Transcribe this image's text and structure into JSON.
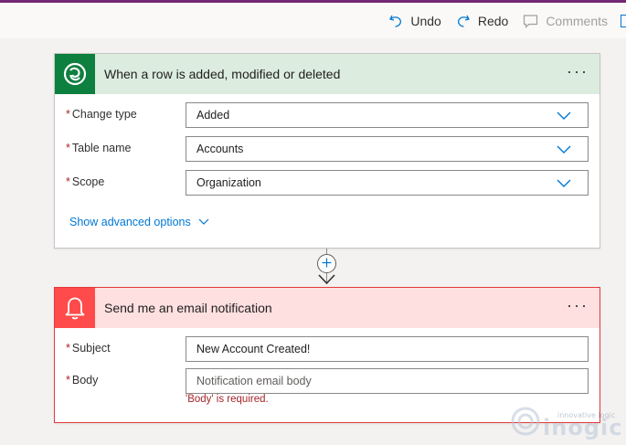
{
  "toolbar": {
    "undo_label": "Undo",
    "redo_label": "Redo",
    "comments_label": "Comments"
  },
  "trigger": {
    "title": "When a row is added, modified or deleted",
    "fields": [
      {
        "label": "Change type",
        "value": "Added"
      },
      {
        "label": "Table name",
        "value": "Accounts"
      },
      {
        "label": "Scope",
        "value": "Organization"
      }
    ],
    "advanced_options_label": "Show advanced options"
  },
  "action": {
    "title": "Send me an email notification",
    "subject_label": "Subject",
    "subject_value": "New Account Created!",
    "body_label": "Body",
    "body_placeholder": "Notification email body",
    "body_error": "'Body' is required."
  },
  "required_marker": "*",
  "more_glyph": "···",
  "watermark": {
    "tagline": "innovative logic",
    "brand": "inogic"
  },
  "colors": {
    "accent": "#742774",
    "dataverse_green": "#0d7f3f",
    "trigger_header": "#dcecdf",
    "notification_red": "#ff4b4b",
    "action_header": "#fde0df",
    "error_red": "#a4262c",
    "link_blue": "#0078d4"
  },
  "icons": {
    "trigger_icon": "dataverse-icon",
    "action_icon": "bell-icon"
  }
}
